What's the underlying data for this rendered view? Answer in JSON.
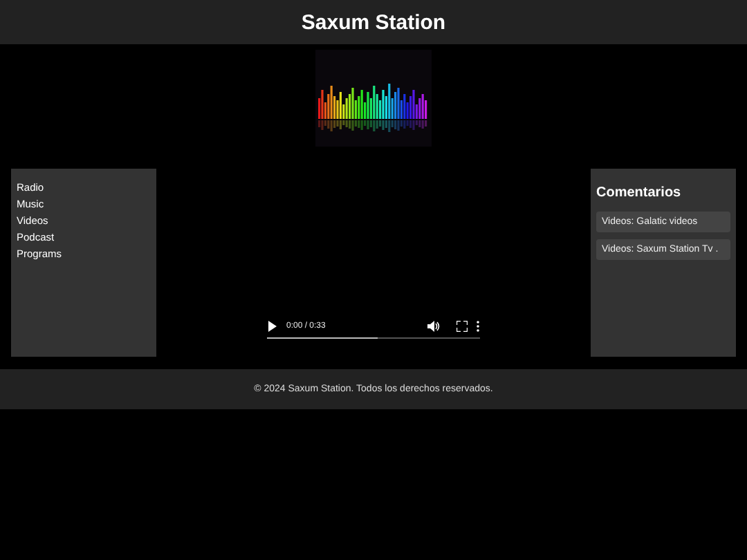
{
  "header": {
    "title": "Saxum Station"
  },
  "nav": {
    "items": [
      "Radio",
      "Music",
      "Videos",
      "Podcast",
      "Programs"
    ]
  },
  "player": {
    "time": "0:00 / 0:33",
    "level": 0.52
  },
  "comments": {
    "title": "Comentarios",
    "items": [
      "Videos: Galatic videos",
      "Videos: Saxum Station Tv ."
    ]
  },
  "footer": {
    "text": "© 2024 Saxum Station. Todos los derechos reservados."
  }
}
